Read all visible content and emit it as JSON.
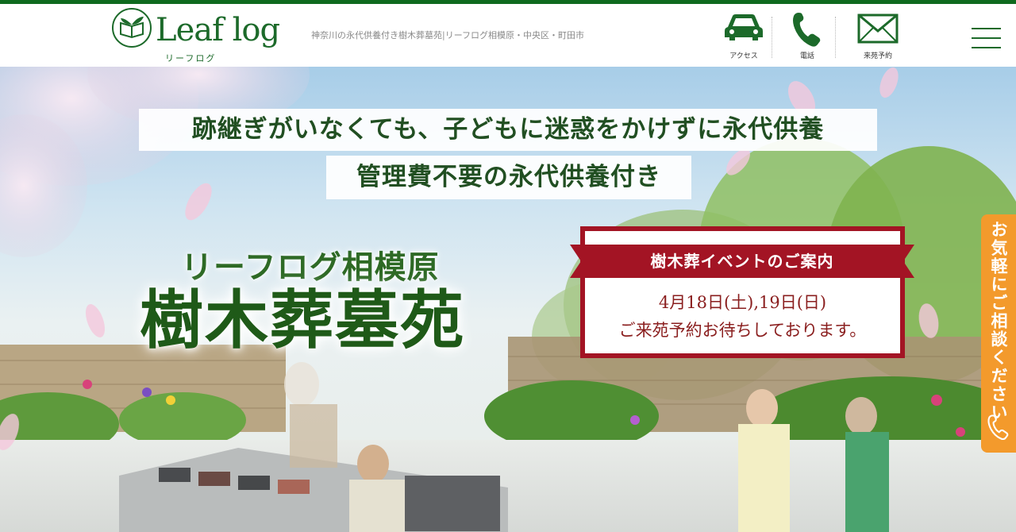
{
  "header": {
    "logo_text": "Leaf log",
    "logo_sub": "リーフログ",
    "tagline": "神奈川の永代供養付き樹木葬墓苑|リーフログ相模原・中央区・町田市",
    "nav": [
      {
        "label": "アクセス",
        "icon": "car-icon"
      },
      {
        "label": "電話",
        "icon": "phone-icon"
      },
      {
        "label": "来苑予約",
        "icon": "mail-icon"
      }
    ],
    "menu_icon": "hamburger-icon"
  },
  "hero": {
    "headline1": "跡継ぎがいなくても、子どもに迷惑をかけずに永代供養",
    "headline2": "管理費不要の永代供養付き",
    "title_small": "リーフログ相模原",
    "title_large": "樹木葬墓苑"
  },
  "event": {
    "ribbon": "樹木葬イベントのご案内",
    "date": "4月18日(土),19日(日)",
    "desc": "ご来苑予約お待ちしております。"
  },
  "sidetab": {
    "text": "お気軽にご相談ください",
    "icon": "phone-icon"
  },
  "colors": {
    "brand_green": "#1c6a2a",
    "event_red": "#a31424",
    "tab_orange": "#f39a2c"
  }
}
